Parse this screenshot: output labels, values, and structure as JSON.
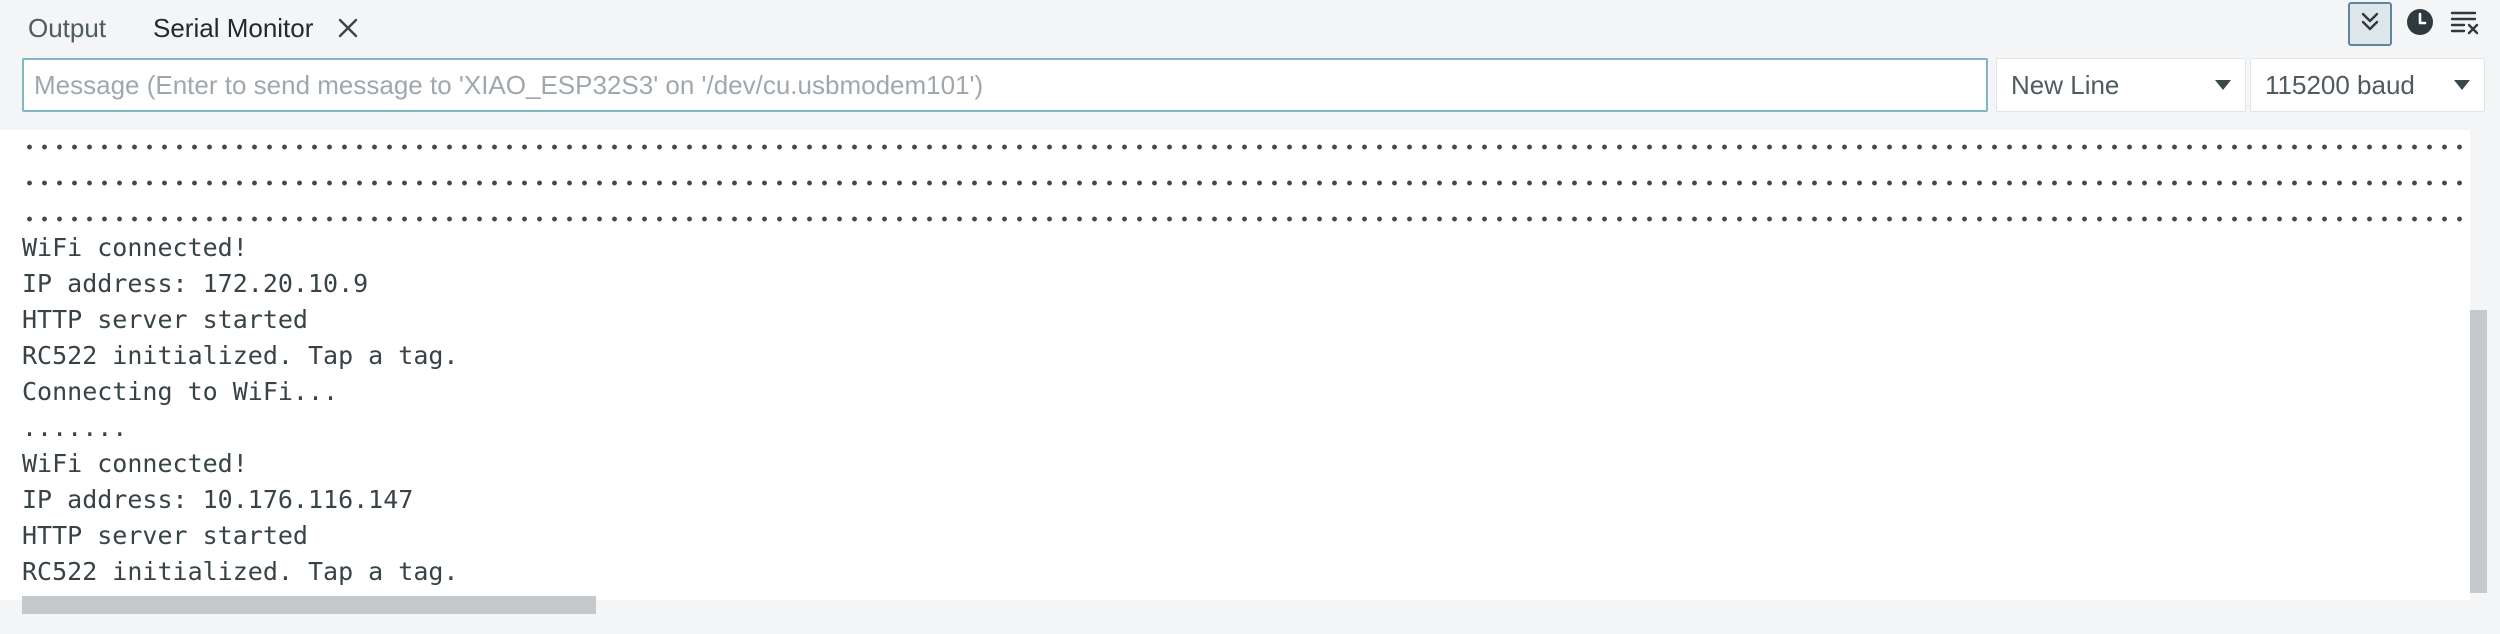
{
  "tabs": [
    {
      "label": "Output"
    },
    {
      "label": "Serial Monitor",
      "active": true
    }
  ],
  "toolbar": {
    "autoscroll": {
      "icon": "chevrons-down-icon",
      "pressed": true
    },
    "timestamp": {
      "icon": "clock-icon"
    },
    "clear": {
      "icon": "clear-output-icon"
    }
  },
  "message": {
    "placeholder": "Message (Enter to send message to 'XIAO_ESP32S3' on '/dev/cu.usbmodem101')",
    "value": ""
  },
  "line_ending": {
    "selected": "New Line"
  },
  "baud_rate": {
    "selected": "115200 baud"
  },
  "console": {
    "lines": [
      "WiFi connected!",
      "IP address: 172.20.10.9",
      "HTTP server started",
      "RC522 initialized. Tap a tag.",
      "Connecting to WiFi...",
      ".......",
      "WiFi connected!",
      "IP address: 10.176.116.147",
      "HTTP server started",
      "RC522 initialized. Tap a tag."
    ]
  },
  "colors": {
    "background": "#f4f5f6",
    "focus_border": "#7fb7c5",
    "text": "#384348"
  }
}
